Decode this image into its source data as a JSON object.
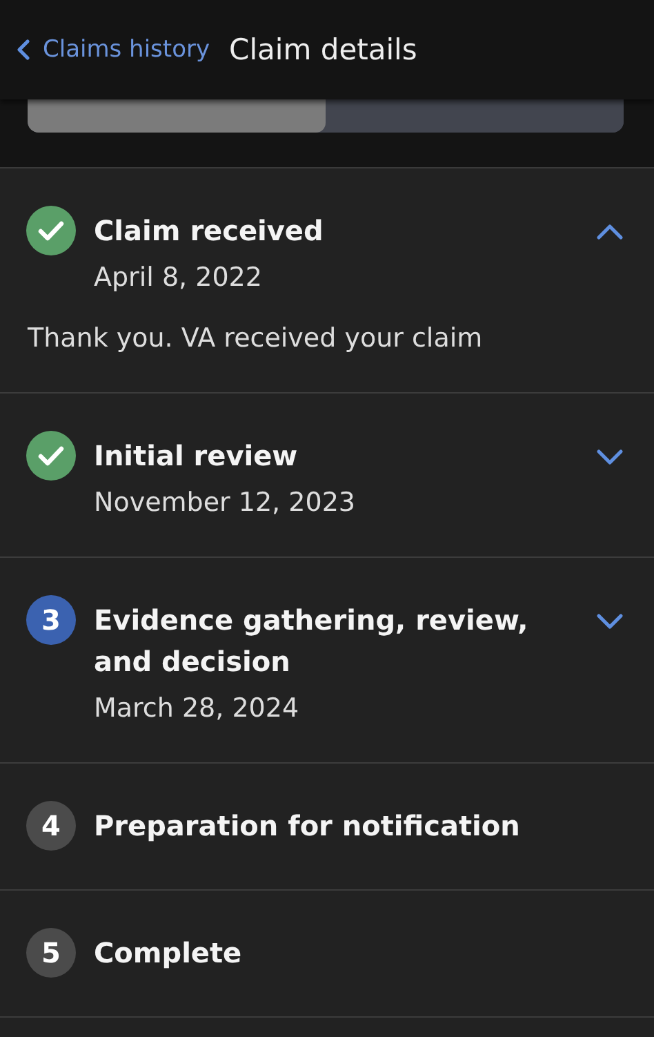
{
  "header": {
    "back_label": "Claims history",
    "title": "Claim details"
  },
  "segments": [
    {
      "selected": true
    },
    {
      "selected": false
    }
  ],
  "steps": [
    {
      "kind": "completed",
      "title": "Claim received",
      "date": "April 8, 2022",
      "expanded": true,
      "description": "Thank you. VA received your claim"
    },
    {
      "kind": "completed",
      "title": "Initial review",
      "date": "November 12, 2023",
      "expanded": false
    },
    {
      "kind": "current",
      "number": "3",
      "title": "Evidence gathering, review, and decision",
      "date": "March 28, 2024",
      "expanded": false
    },
    {
      "kind": "pending",
      "number": "4",
      "title": "Preparation for notification"
    },
    {
      "kind": "pending",
      "number": "5",
      "title": "Complete"
    }
  ]
}
